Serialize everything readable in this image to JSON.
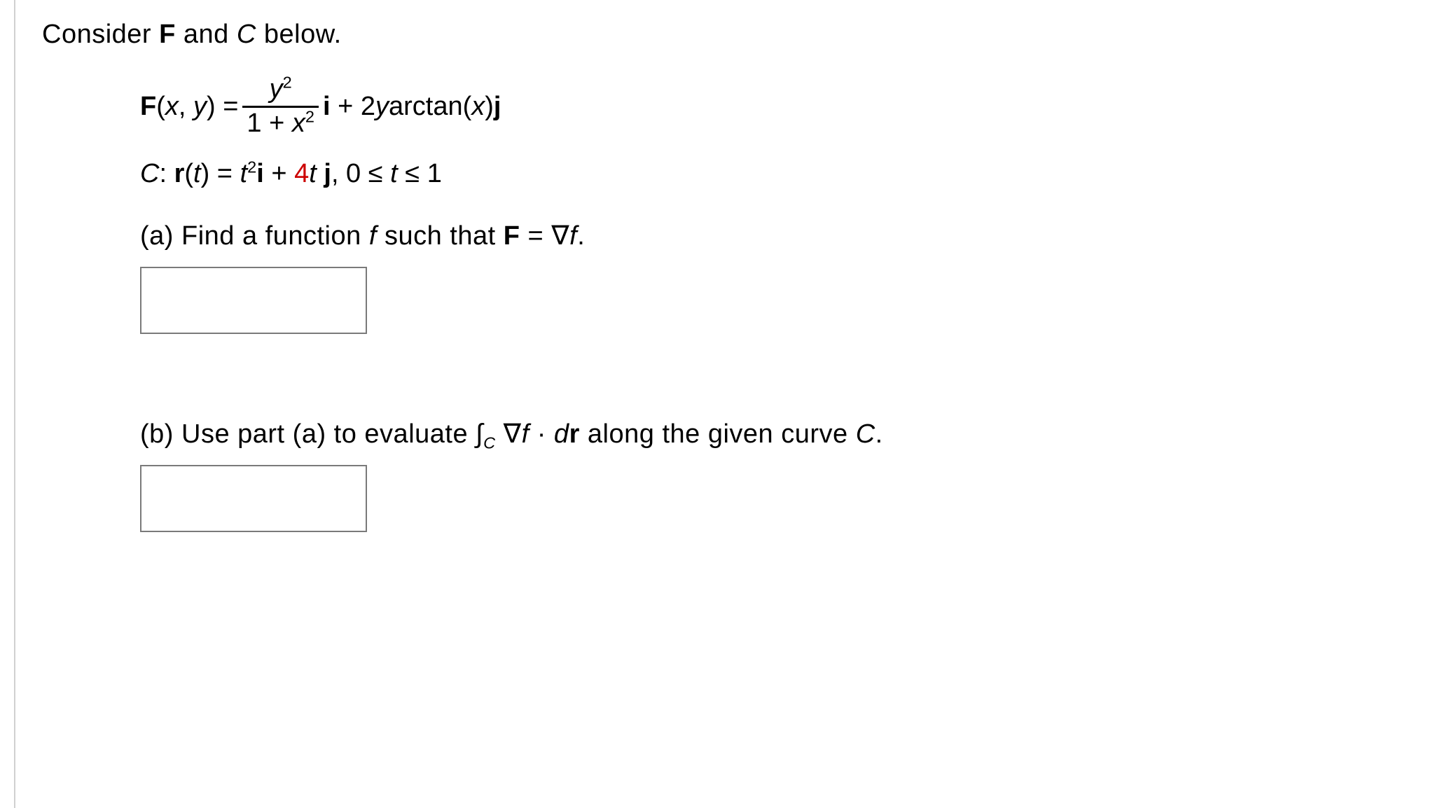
{
  "intro_prefix": "Consider ",
  "intro_F": "F",
  "intro_mid": " and ",
  "intro_C": "C",
  "intro_suffix": " below.",
  "eq_lhs_F": "F",
  "eq_lhs_args": "(",
  "eq_lhs_x": "x",
  "eq_lhs_comma": ", ",
  "eq_lhs_y": "y",
  "eq_lhs_close": ") = ",
  "frac_num_y": "y",
  "frac_num_exp": "2",
  "frac_den_one": "1 + ",
  "frac_den_x": "x",
  "frac_den_exp": "2",
  "eq_i": "i",
  "eq_plus2y": " + 2",
  "eq_y2": "y",
  "eq_arctan": "arctan(",
  "eq_x2": "x",
  "eq_close2": ")",
  "eq_j": "j",
  "curve_C": "C",
  "curve_colon": ": ",
  "curve_r": "r",
  "curve_paren": "(",
  "curve_t": "t",
  "curve_close_eq": ") = ",
  "curve_t2": "t",
  "curve_exp2": "2",
  "curve_i": "i",
  "curve_plus": " + ",
  "curve_4t": "4",
  "curve_tj": "t ",
  "curve_j": "j",
  "curve_range_pre": ", 0 ≤ ",
  "curve_range_t": "t",
  "curve_range_post": " ≤ 1",
  "part_a_label": "(a) Find a function ",
  "part_a_f": "f",
  "part_a_mid": " such that ",
  "part_a_F": "F",
  "part_a_eq": " = ",
  "part_a_nabla": "∇",
  "part_a_f2": "f",
  "part_a_period": ".",
  "part_b_label": "(b) Use part (a) to evaluate ",
  "part_b_int": "∫",
  "part_b_sub": "C",
  "part_b_space": " ",
  "part_b_nabla": "∇",
  "part_b_f": "f",
  "part_b_dot": " · ",
  "part_b_d": "d",
  "part_b_r": "r",
  "part_b_rest": " along the given curve ",
  "part_b_C": "C",
  "part_b_period": "."
}
